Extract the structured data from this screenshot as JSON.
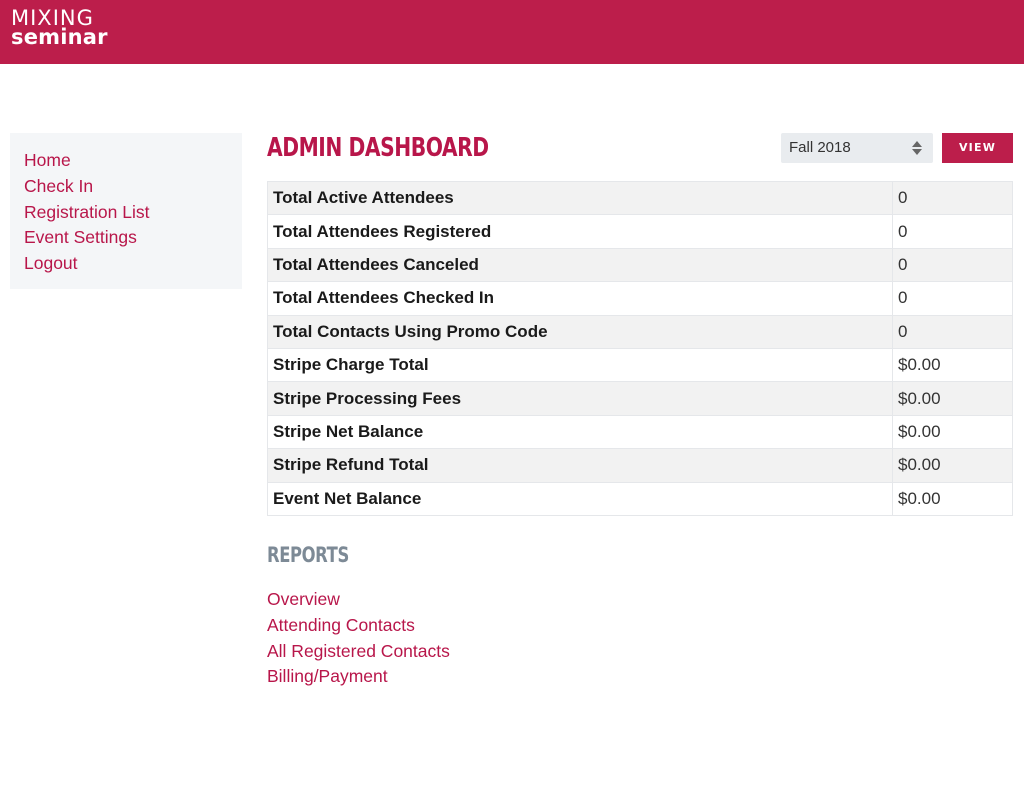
{
  "brand": {
    "logo_top": "MIXING",
    "logo_bottom": "seminar",
    "color": "#bc1e4b"
  },
  "sidebar": {
    "items": [
      {
        "label": "Home"
      },
      {
        "label": "Check In"
      },
      {
        "label": "Registration List"
      },
      {
        "label": "Event Settings"
      },
      {
        "label": "Logout"
      }
    ]
  },
  "main": {
    "title": "ADMIN DASHBOARD",
    "event_select": {
      "value": "Fall 2018",
      "icon": "sort-arrows-icon"
    },
    "view_button": "VIEW",
    "stats": [
      {
        "label": "Total Active Attendees",
        "value": "0"
      },
      {
        "label": "Total Attendees Registered",
        "value": "0"
      },
      {
        "label": "Total Attendees Canceled",
        "value": "0"
      },
      {
        "label": "Total Attendees Checked In",
        "value": "0"
      },
      {
        "label": "Total Contacts Using Promo Code",
        "value": "0"
      },
      {
        "label": "Stripe Charge Total",
        "value": "$0.00"
      },
      {
        "label": "Stripe Processing Fees",
        "value": "$0.00"
      },
      {
        "label": "Stripe Net Balance",
        "value": "$0.00"
      },
      {
        "label": "Stripe Refund Total",
        "value": "$0.00"
      },
      {
        "label": "Event Net Balance",
        "value": "$0.00"
      }
    ],
    "reports_heading": "REPORTS",
    "reports": [
      {
        "label": "Overview"
      },
      {
        "label": "Attending Contacts"
      },
      {
        "label": "All Registered Contacts"
      },
      {
        "label": "Billing/Payment"
      }
    ]
  }
}
